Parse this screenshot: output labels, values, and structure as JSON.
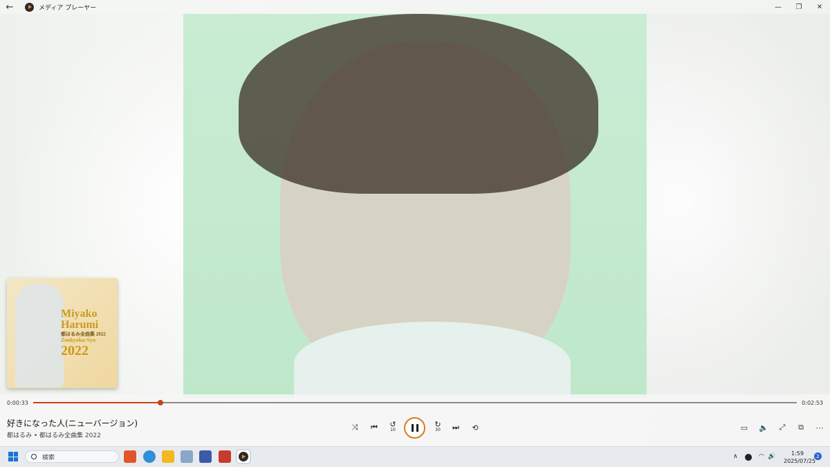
{
  "window": {
    "title": "メディア プレーヤー",
    "back_glyph": "←",
    "minimize_glyph": "—",
    "restore_glyph": "❐",
    "close_glyph": "✕"
  },
  "album_art": {
    "thumbnail": {
      "line1": "Miyako",
      "line2": "Harumi",
      "line3": "都はるみ全曲集 2022",
      "line4": "Zenkyoku-Syu",
      "line5": "2022"
    }
  },
  "playback": {
    "current_time": "0:00:33",
    "duration": "0:02:53",
    "progress_fraction": 0.167
  },
  "track": {
    "title": "好きになった人(ニューバージョン)",
    "subtitle": "都はるみ • 都はるみ全曲集 2022"
  },
  "controls": {
    "shuffle_icon": "⤨",
    "previous_icon": "⏮",
    "skip_back_icon": "↺",
    "skip_back_seconds": "10",
    "skip_forward_icon": "↻",
    "skip_forward_seconds": "30",
    "next_icon": "⏭",
    "repeat_icon": "⟲"
  },
  "right_controls": {
    "captions_icon": "▭",
    "volume_icon": "🔈",
    "fullscreen_icon": "⤢",
    "miniplayer_icon": "⧉",
    "more_icon": "⋯"
  },
  "taskbar": {
    "search_placeholder": "検索",
    "time": "1:59",
    "date": "2025/07/25",
    "notification_count": "2",
    "tray_chevron": "∧",
    "wifi_icon": "◠",
    "volume_icon": "🔊",
    "battery_icon": "▭"
  },
  "colors": {
    "accent": "#c44514",
    "play_ring": "#d97c1a",
    "art_background": "#c2e9cd"
  }
}
